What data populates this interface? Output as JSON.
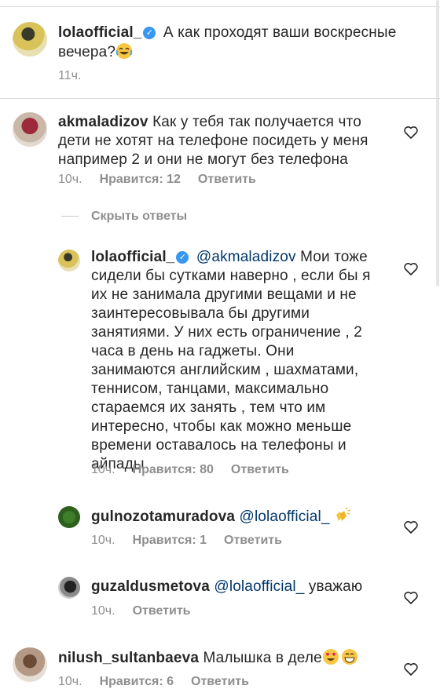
{
  "post_caption": {
    "username": "lolaofficial_",
    "text_line1": "А как проходят ваши воскресные",
    "text_line2": "вечера?",
    "time": "11ч."
  },
  "comments": [
    {
      "username": "akmaladizov",
      "lines": [
        "Как у тебя так получается что",
        "дети не хотят на телефоне посидеть у меня",
        "например 2 и они не могут без телефона"
      ],
      "time": "10ч.",
      "likes": "Нравится: 12",
      "reply_label": "Ответить"
    }
  ],
  "hide_replies_label": "Скрыть ответы",
  "replies": [
    {
      "username": "lolaofficial_",
      "mention": "@akmaladizov",
      "lines": [
        "Мои тоже",
        "сидели бы сутками наверно , если бы я",
        "их не занимала другими вещами и не",
        "заинтересовывала бы другими",
        "занятиями. У них есть ограничение , 2",
        "часа в день на гаджеты. Они",
        "занимаются английским , шахматами,",
        "теннисом, танцами, максимально",
        "стараемся их занять , тем что им",
        "интересно, чтобы как можно меньше",
        "времени оставалось на телефоны и",
        "айпады"
      ],
      "time": "10ч.",
      "likes": "Нравится: 80",
      "reply_label": "Ответить"
    },
    {
      "username": "gulnozotamuradova",
      "mention": "@lolaofficial_",
      "time": "10ч.",
      "likes": "Нравится: 1",
      "reply_label": "Ответить"
    },
    {
      "username": "guzaldusmetova",
      "mention": "@lolaofficial_",
      "text": "уважаю",
      "time": "10ч.",
      "reply_label": "Ответить"
    }
  ],
  "last_comment": {
    "username": "nilush_sultanbaeva",
    "text": "Малышка в деле",
    "time": "10ч.",
    "likes": "Нравится: 6",
    "reply_label": "Ответить"
  },
  "icons": {
    "verified": "verified-badge-icon",
    "heart": "heart-outline-icon",
    "emoji_laugh": "laughing-emoji",
    "emoji_clap": "clapping-hands-emoji",
    "emoji_heart_eyes": "heart-eyes-emoji",
    "emoji_grin": "grinning-emoji"
  },
  "colors": {
    "verified": "#3897f0",
    "mention": "#00376b",
    "meta": "#8e8e8e"
  }
}
